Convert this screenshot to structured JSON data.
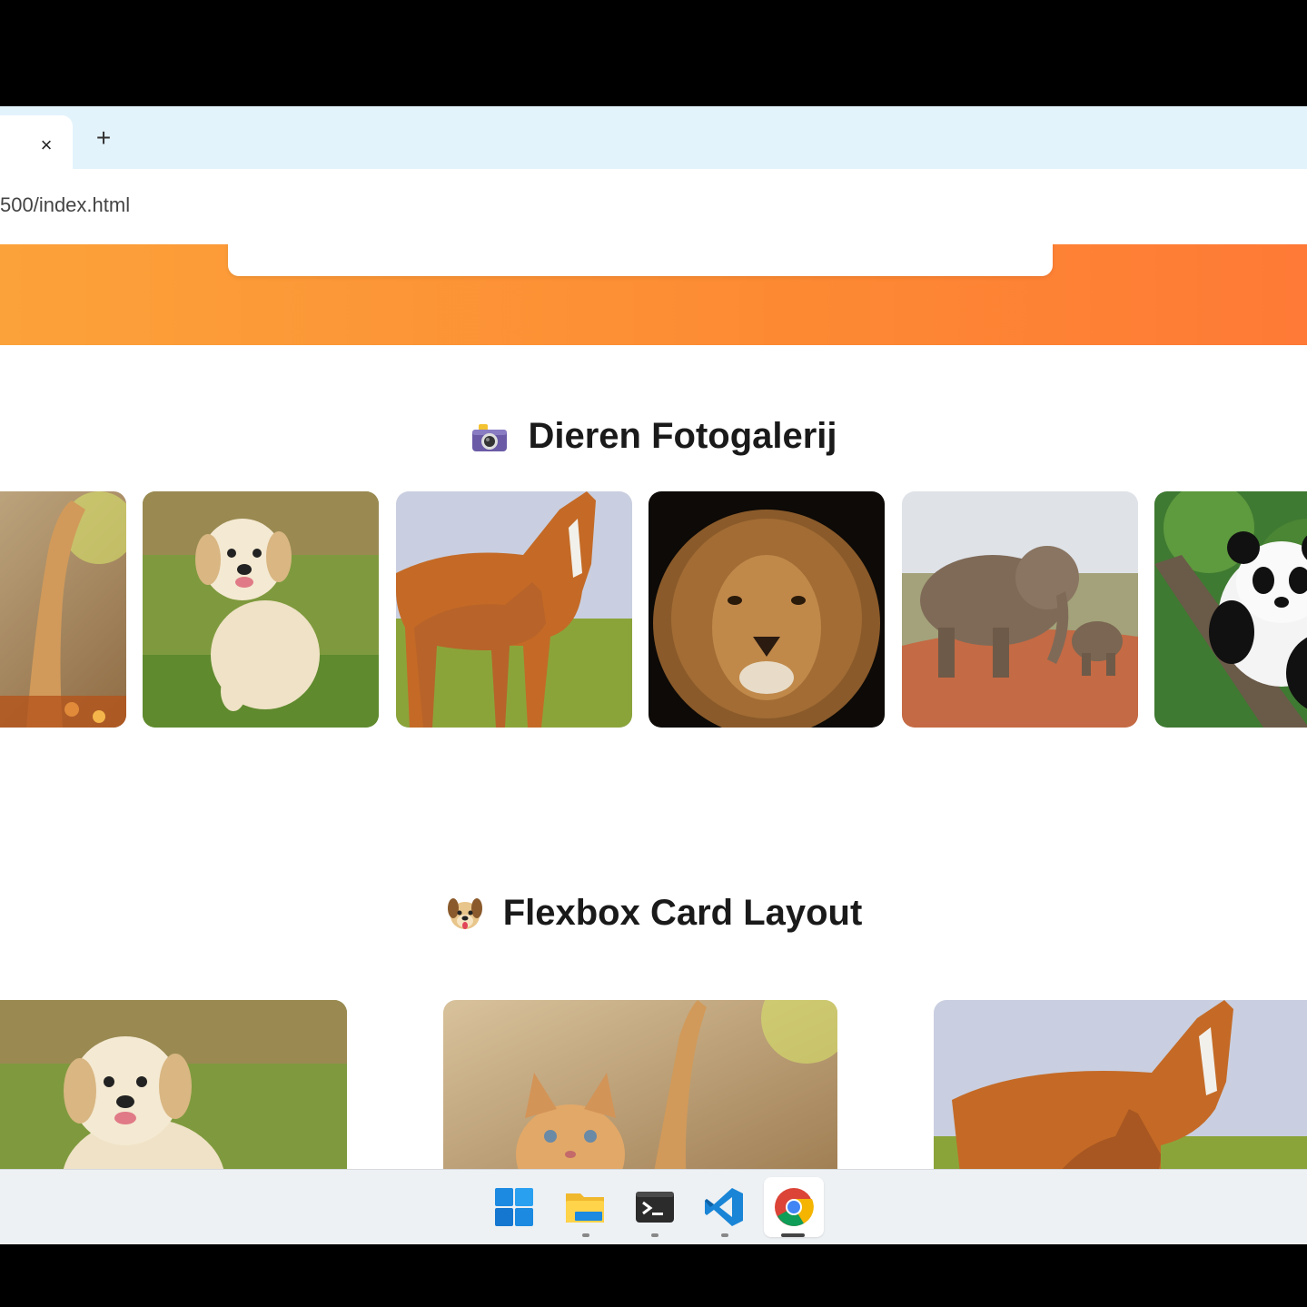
{
  "browser": {
    "tab_close": "×",
    "new_tab": "+",
    "address": "500/index.html"
  },
  "sections": {
    "gallery_title": "Dieren Fotogalerij",
    "cards_title": "Flexbox Card Layout"
  },
  "gallery": [
    {
      "animal": "kitten"
    },
    {
      "animal": "puppy"
    },
    {
      "animal": "horses"
    },
    {
      "animal": "lion"
    },
    {
      "animal": "elephants"
    },
    {
      "animal": "panda"
    }
  ],
  "cards": [
    {
      "animal": "puppy"
    },
    {
      "animal": "kitten"
    },
    {
      "animal": "horses"
    }
  ],
  "taskbar": {
    "apps": [
      "windows-start-icon",
      "file-explorer-icon",
      "terminal-icon",
      "vscode-icon",
      "chrome-icon"
    ],
    "active": "chrome-icon"
  },
  "colors": {
    "hero_start": "#fca23a",
    "hero_end": "#fe7a36",
    "tabbar": "#e3f3fc"
  }
}
